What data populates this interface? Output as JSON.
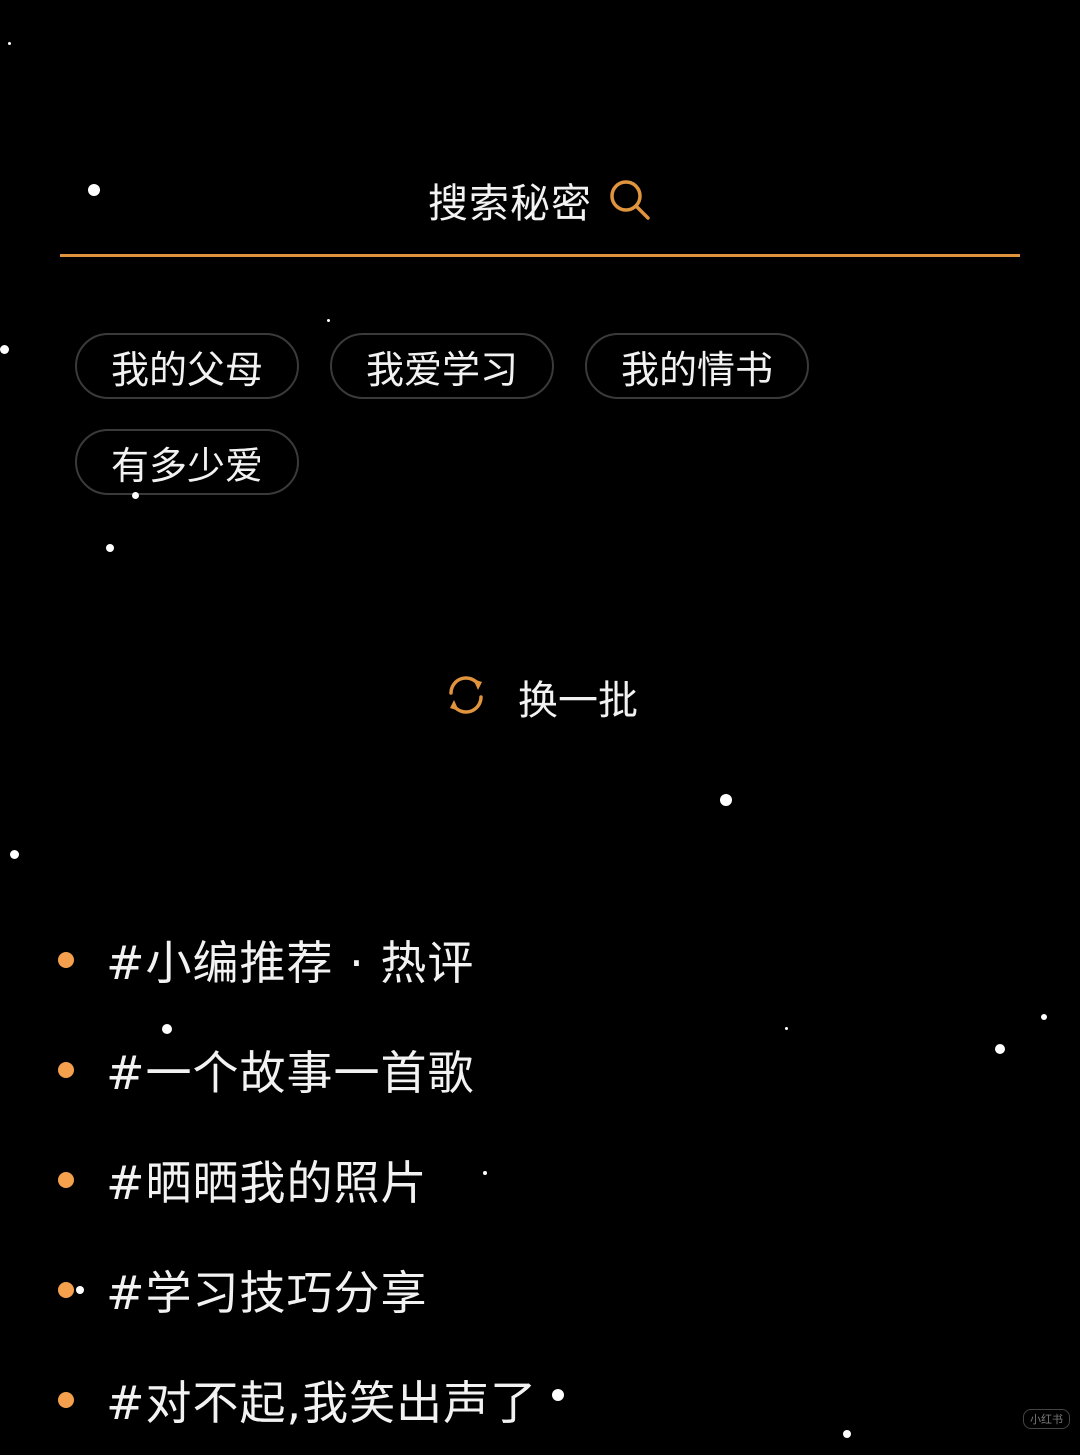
{
  "search": {
    "label": "搜索秘密",
    "icon": "search-icon",
    "underline_color": "#e0943e"
  },
  "tags": [
    {
      "label": "我的父母"
    },
    {
      "label": "我爱学习"
    },
    {
      "label": "我的情书"
    },
    {
      "label": "有多少爱"
    }
  ],
  "refresh": {
    "label": "换一批",
    "icon": "refresh-icon",
    "icon_color": "#e0943e"
  },
  "topics": [
    {
      "label": "#小编推荐 · 热评"
    },
    {
      "label": "#一个故事一首歌"
    },
    {
      "label": "#晒晒我的照片"
    },
    {
      "label": "#学习技巧分享"
    },
    {
      "label": "#对不起,我笑出声了"
    }
  ],
  "colors": {
    "background": "#000000",
    "accent": "#f4a04c",
    "text": "#f2f2f2"
  },
  "watermark": "小红书"
}
